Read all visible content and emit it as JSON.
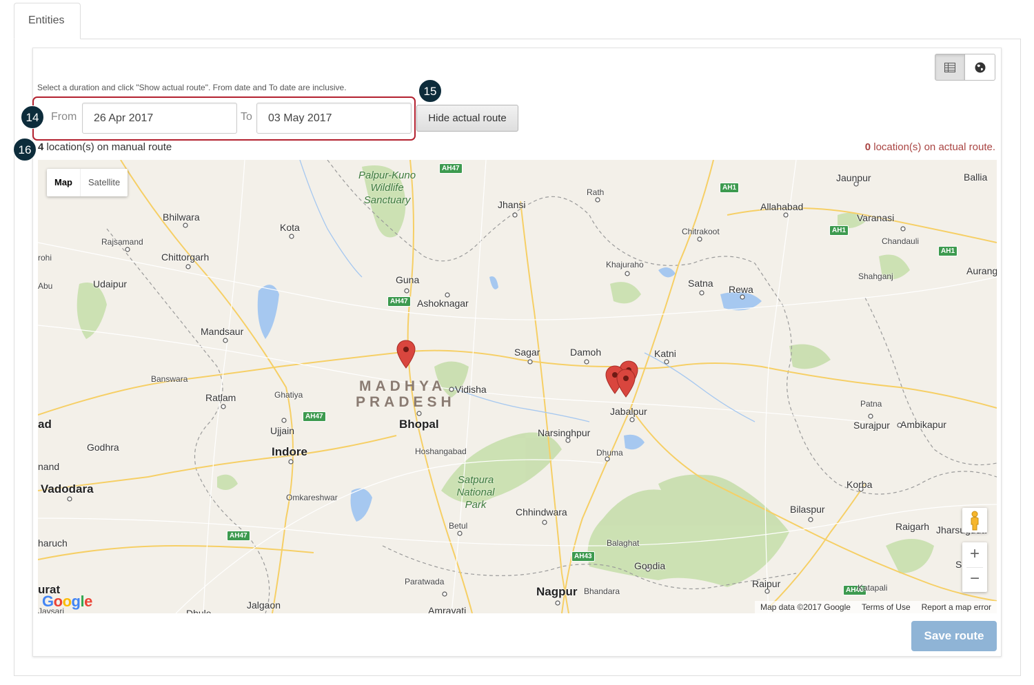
{
  "tabs": [
    {
      "label": "Entities"
    }
  ],
  "toolbar": {
    "table_view_icon": "table-icon",
    "map_view_icon": "globe-icon"
  },
  "hint": "Select a duration and click \"Show actual route\". From date and To date are inclusive.",
  "form": {
    "from_label": "From",
    "from_value": "26 Apr 2017",
    "to_label": "To",
    "to_value": "03 May 2017",
    "toggle_button": "Hide actual route"
  },
  "badges": [
    "14",
    "15",
    "16"
  ],
  "counts": {
    "manual_number": "4",
    "manual_text": " location(s) on manual route",
    "actual_number": "0",
    "actual_text": " location(s) on actual route."
  },
  "map": {
    "type_buttons": [
      "Map",
      "Satellite"
    ],
    "cities": [
      {
        "name": "Jhansi"
      },
      {
        "name": "Rath"
      },
      {
        "name": "Jaunpur"
      },
      {
        "name": "Ballia"
      },
      {
        "name": "Allahabad"
      },
      {
        "name": "Varanasi"
      },
      {
        "name": "Chitrakoot"
      },
      {
        "name": "Chandauli"
      },
      {
        "name": "Bhilwara"
      },
      {
        "name": "Kota"
      },
      {
        "name": "Rajsamand"
      },
      {
        "name": "Chittorgarh"
      },
      {
        "name": "rohi"
      },
      {
        "name": "Khajuraho"
      },
      {
        "name": "Shahganj"
      },
      {
        "name": "Aurang"
      },
      {
        "name": "Abu"
      },
      {
        "name": "Udaipur"
      },
      {
        "name": "Guna"
      },
      {
        "name": "Ashoknagar"
      },
      {
        "name": "Satna"
      },
      {
        "name": "Rewa"
      },
      {
        "name": "Mandsaur"
      },
      {
        "name": "Sagar"
      },
      {
        "name": "Damoh"
      },
      {
        "name": "Katni"
      },
      {
        "name": "Banswara"
      },
      {
        "name": "Vidisha"
      },
      {
        "name": "Ratlam"
      },
      {
        "name": "Ghatiya"
      },
      {
        "name": "Jabalpur"
      },
      {
        "name": "Patna"
      },
      {
        "name": "ad"
      },
      {
        "name": "Ujjain"
      },
      {
        "name": "Bhopal"
      },
      {
        "name": "Surajpur"
      },
      {
        "name": "Ambikapur"
      },
      {
        "name": "Narsinghpur"
      },
      {
        "name": "Godhra"
      },
      {
        "name": "Indore"
      },
      {
        "name": "Hoshangabad"
      },
      {
        "name": "Dhuma"
      },
      {
        "name": "nand"
      },
      {
        "name": "Vadodara"
      },
      {
        "name": "Omkareshwar"
      },
      {
        "name": "Korba"
      },
      {
        "name": "Chhindwara"
      },
      {
        "name": "Bilaspur"
      },
      {
        "name": "Betul"
      },
      {
        "name": "Raigarh"
      },
      {
        "name": "Jharsuguda"
      },
      {
        "name": "haruch"
      },
      {
        "name": "Balaghat"
      },
      {
        "name": "Gondia"
      },
      {
        "name": "Samb"
      },
      {
        "name": "Paratwada"
      },
      {
        "name": "Raipur"
      },
      {
        "name": "Nagpur"
      },
      {
        "name": "Bhandara"
      },
      {
        "name": "Katapali"
      },
      {
        "name": "urat"
      },
      {
        "name": "Jalgaon"
      },
      {
        "name": "Amravati"
      },
      {
        "name": "Dhule"
      },
      {
        "name": "Jaysari"
      }
    ],
    "parks": [
      "Palpur-Kuno Wildlife Sanctuary",
      "Satpura National Park"
    ],
    "state_label": [
      "MADHYA",
      "PRADESH"
    ],
    "highways": [
      "AH47",
      "AH1",
      "AH43",
      "AH46"
    ],
    "attribution": {
      "data": "Map data ©2017 Google",
      "terms": "Terms of Use",
      "report": "Report a map error"
    },
    "logo": "Google",
    "controls": {
      "pegman_icon": "pegman-icon",
      "zoom_in": "+",
      "zoom_out": "−"
    }
  },
  "save_button": "Save route",
  "colors": {
    "accent_border": "#b3212f",
    "badge": "#0d2c3b",
    "save": "#8fb4d6",
    "marker": "#d9463e"
  }
}
